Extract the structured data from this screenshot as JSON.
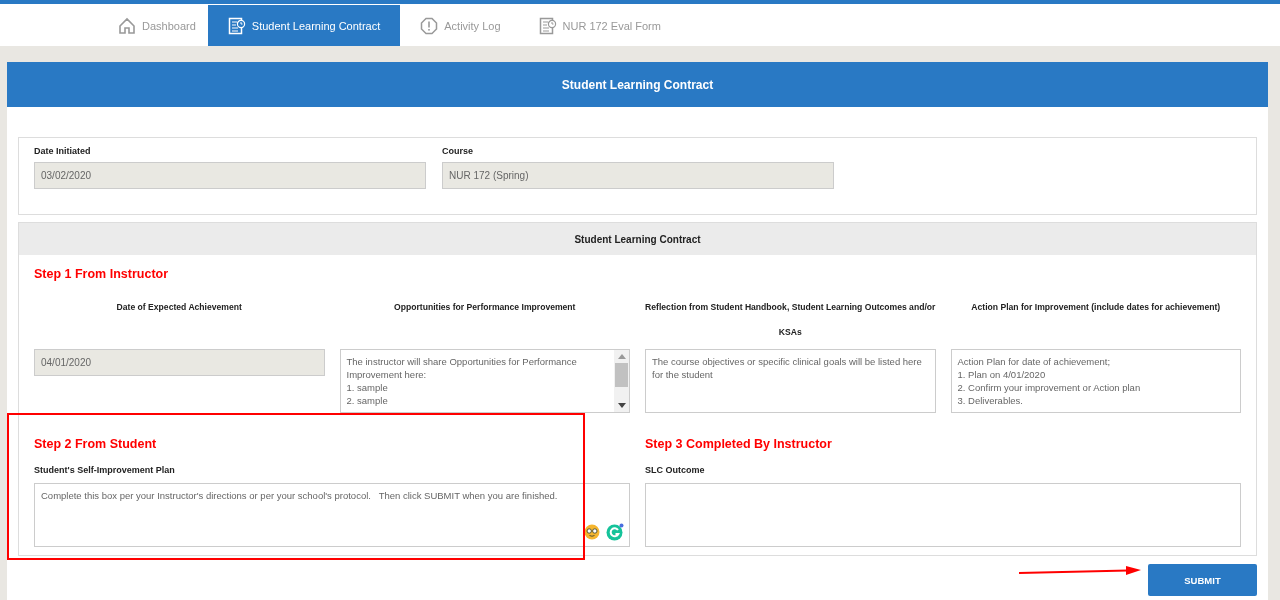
{
  "tabs": [
    {
      "label": "Dashboard",
      "selected": false
    },
    {
      "label": "Student Learning Contract",
      "selected": true
    },
    {
      "label": "Activity Log",
      "selected": false
    },
    {
      "label": "NUR 172 Eval Form",
      "selected": false
    }
  ],
  "header": {
    "title": "Student Learning Contract"
  },
  "info": {
    "fields": [
      {
        "label": "Date Initiated",
        "value": "03/02/2020"
      },
      {
        "label": "Course",
        "value": "NUR 172 (Spring)"
      }
    ]
  },
  "contract": {
    "title": "Student Learning Contract",
    "step1": {
      "heading": "Step 1 From Instructor",
      "columns": [
        {
          "label": "Date of Expected Achievement",
          "kind": "input",
          "value": "04/01/2020"
        },
        {
          "label": "Opportunities for Performance Improvement",
          "kind": "scrollarea",
          "lines": [
            "The instructor will share Opportunities for Performance Improvement here:",
            "1.  sample",
            "2.  sample"
          ]
        },
        {
          "label": "Reflection from Student Handbook, Student Learning Outcomes and/or KSAs",
          "kind": "area",
          "lines": [
            "The course objectives or specific clinical goals will be listed here for the student"
          ]
        },
        {
          "label": "Action Plan for Improvement (include dates for achievement)",
          "kind": "area",
          "lines": [
            "Action Plan for date of achievement;",
            "1.  Plan on 4/01/2020",
            "2.  Confirm your improvement or Action plan",
            "3. Deliverables."
          ]
        }
      ]
    },
    "step2": {
      "heading": "Step 2 From Student",
      "label": "Student's Self-Improvement Plan",
      "placeholder": "Complete this box per your Instructor's directions or per your school's protocol.   Then click SUBMIT when you are finished."
    },
    "step3": {
      "heading": "Step 3 Completed By Instructor",
      "label": "SLC Outcome"
    }
  },
  "submit": "SUBMIT",
  "annotations": {
    "highlight_box": true,
    "arrow": true
  }
}
